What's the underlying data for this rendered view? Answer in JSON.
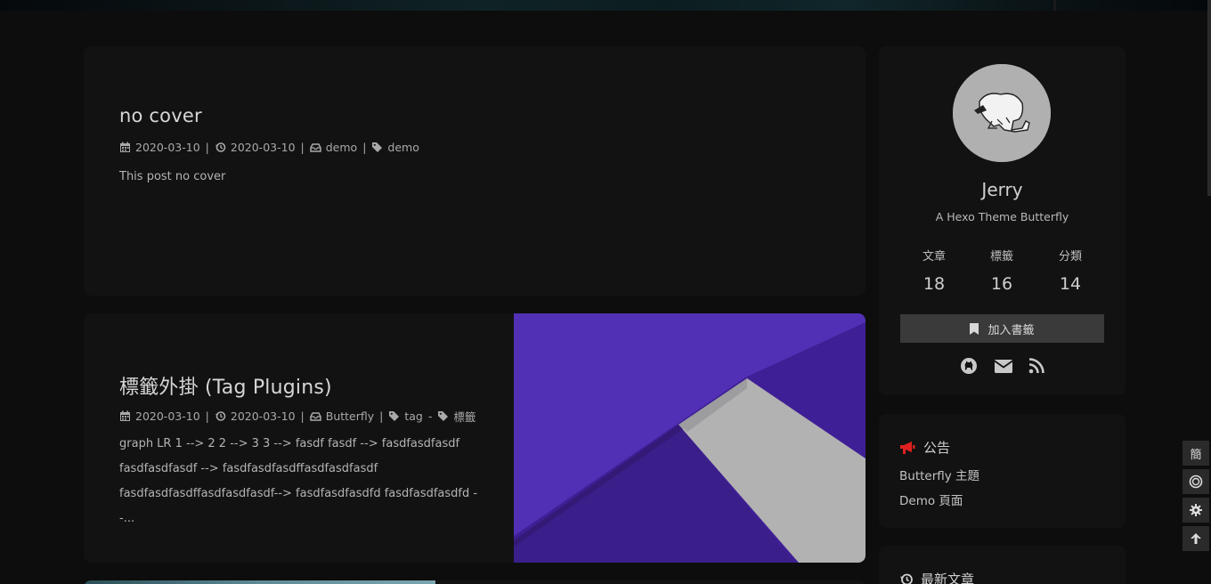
{
  "posts": [
    {
      "title": "no cover",
      "created": "2020-03-10",
      "updated": "2020-03-10",
      "category": "demo",
      "tags": [
        "demo"
      ],
      "excerpt": "This post no cover"
    },
    {
      "title": "標籤外掛 (Tag Plugins)",
      "created": "2020-03-10",
      "updated": "2020-03-10",
      "category": "Butterfly",
      "tags": [
        "tag",
        "標籤"
      ],
      "tag_separator": "-",
      "excerpt_lines": [
        "graph LR 1 --> 2 2 --> 3 3 --> fasdf fasdf --> fasdfasdfasdf",
        "fasdfasdfasdf --> fasdfasdfasdffasdfasdfasdf",
        "fasdfasdfasdffasdfasdfasdf--> fasdfasdfasdfd fasdfasdfasdfd --..."
      ]
    }
  ],
  "meta_separator": "|",
  "profile": {
    "name": "Jerry",
    "description": "A Hexo Theme Butterfly",
    "stats": [
      {
        "label": "文章",
        "value": "18"
      },
      {
        "label": "標籤",
        "value": "16"
      },
      {
        "label": "分類",
        "value": "14"
      }
    ],
    "bookmark_label": "加入書籤",
    "social_icons": [
      "github-icon",
      "mail-icon",
      "rss-icon"
    ]
  },
  "announcement": {
    "title": "公告",
    "lines": [
      "Butterfly 主題",
      "Demo 頁面"
    ]
  },
  "recent_posts": {
    "title": "最新文章"
  },
  "rightside_buttons": [
    {
      "label": "簡",
      "icon": "translate-icon"
    },
    {
      "icon": "theme-toggle-icon"
    },
    {
      "icon": "settings-gear-icon"
    },
    {
      "icon": "arrow-up-icon"
    }
  ],
  "colors": {
    "background": "#0d0d0d",
    "card": "#121212",
    "accent_red": "#e02020",
    "cover_purple": "#5230b5"
  }
}
